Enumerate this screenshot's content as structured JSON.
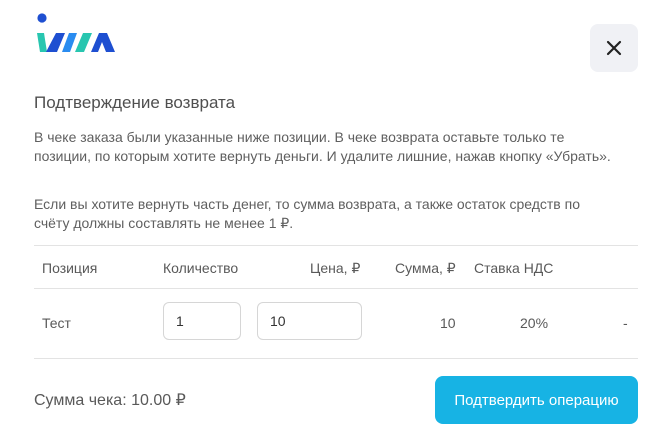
{
  "header": {
    "logo_icon": "ima-logo-icon",
    "close_icon": "close-icon"
  },
  "dialog": {
    "title": "Подтверждение возврата",
    "paragraph1": "В чеке заказа были указанные ниже позиции. В чеке возврата оставьте только те позиции, по которым хотите вернуть деньги. И удалите лишние, нажав кнопку «Убрать».",
    "paragraph2": "Если вы хотите вернуть часть денег, то сумма возврата, а также остаток средств по счёту должны составлять не менее 1 ₽."
  },
  "table": {
    "headers": {
      "position": "Позиция",
      "quantity": "Количество",
      "price": "Цена, ₽",
      "sum": "Сумма, ₽",
      "vat": "Ставка НДС"
    },
    "rows": [
      {
        "position": "Тест",
        "quantity": "1",
        "price": "10",
        "sum": "10",
        "vat": "20%",
        "action": "-"
      }
    ]
  },
  "footer": {
    "total": "Сумма чека: 10.00 ₽",
    "confirm_label": "Подтвердить операцию"
  },
  "colors": {
    "accent": "#17b3e4",
    "logo_dark": "#1e4fd1",
    "logo_teal": "#28c6b0",
    "logo_blue": "#2a8cf0"
  }
}
